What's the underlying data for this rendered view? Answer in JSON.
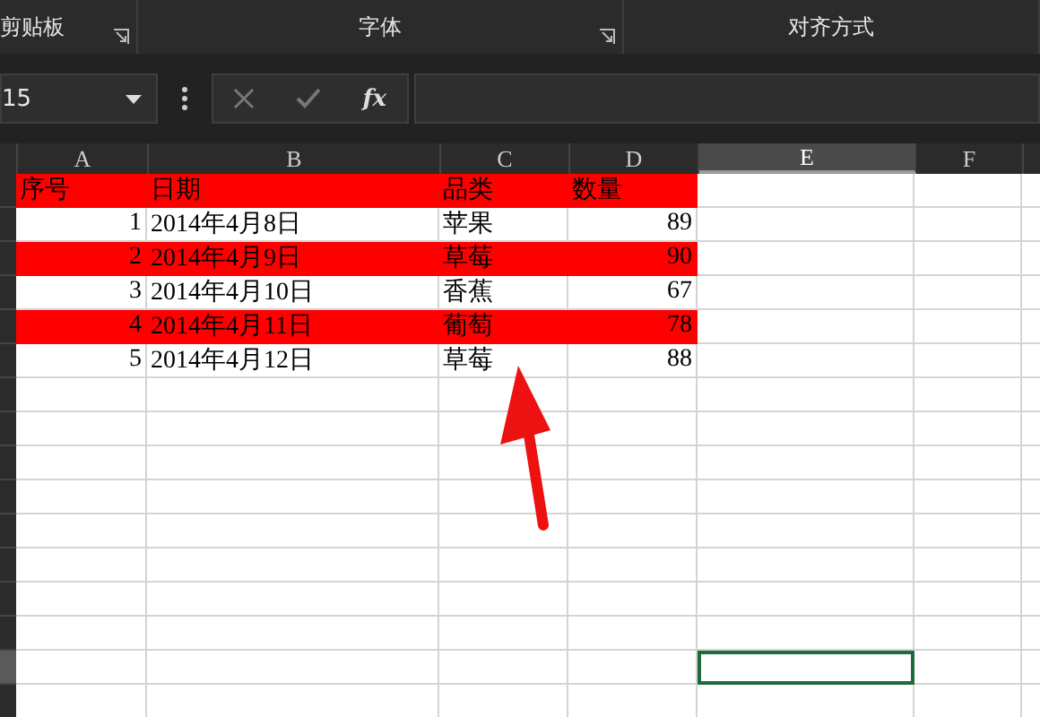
{
  "ribbon": {
    "groups": [
      {
        "label": "剪贴板",
        "launcher": true
      },
      {
        "label": "字体",
        "launcher": true
      },
      {
        "label": "对齐方式",
        "launcher": false
      }
    ]
  },
  "formula_bar": {
    "name_box": "15",
    "function_label": "fx"
  },
  "sheet": {
    "columns": [
      {
        "label": "A",
        "selected": false
      },
      {
        "label": "B",
        "selected": false
      },
      {
        "label": "C",
        "selected": false
      },
      {
        "label": "D",
        "selected": false
      },
      {
        "label": "E",
        "selected": true
      },
      {
        "label": "F",
        "selected": false
      }
    ],
    "rows": [
      {
        "kind": "header",
        "highlighted": true,
        "selected": false,
        "cells": [
          "序号",
          "日期",
          "品类",
          "数量"
        ]
      },
      {
        "kind": "data",
        "highlighted": false,
        "selected": false,
        "cells": [
          "1",
          "2014年4月8日",
          "苹果",
          "89"
        ]
      },
      {
        "kind": "data",
        "highlighted": true,
        "selected": false,
        "cells": [
          "2",
          "2014年4月9日",
          "草莓",
          "90"
        ]
      },
      {
        "kind": "data",
        "highlighted": false,
        "selected": false,
        "cells": [
          "3",
          "2014年4月10日",
          "香蕉",
          "67"
        ]
      },
      {
        "kind": "data",
        "highlighted": true,
        "selected": false,
        "cells": [
          "4",
          "2014年4月11日",
          "葡萄",
          "78"
        ]
      },
      {
        "kind": "data",
        "highlighted": false,
        "selected": false,
        "cells": [
          "5",
          "2014年4月12日",
          "草莓",
          "88"
        ]
      },
      {
        "kind": "empty",
        "highlighted": false,
        "selected": false,
        "cells": []
      },
      {
        "kind": "empty",
        "highlighted": false,
        "selected": false,
        "cells": []
      },
      {
        "kind": "empty",
        "highlighted": false,
        "selected": false,
        "cells": []
      },
      {
        "kind": "empty",
        "highlighted": false,
        "selected": false,
        "cells": []
      },
      {
        "kind": "empty",
        "highlighted": false,
        "selected": false,
        "cells": []
      },
      {
        "kind": "empty",
        "highlighted": false,
        "selected": false,
        "cells": []
      },
      {
        "kind": "empty",
        "highlighted": false,
        "selected": false,
        "cells": []
      },
      {
        "kind": "empty",
        "highlighted": false,
        "selected": false,
        "cells": []
      },
      {
        "kind": "empty",
        "highlighted": false,
        "selected": true,
        "cells": []
      },
      {
        "kind": "empty",
        "highlighted": false,
        "selected": false,
        "cells": []
      }
    ]
  }
}
